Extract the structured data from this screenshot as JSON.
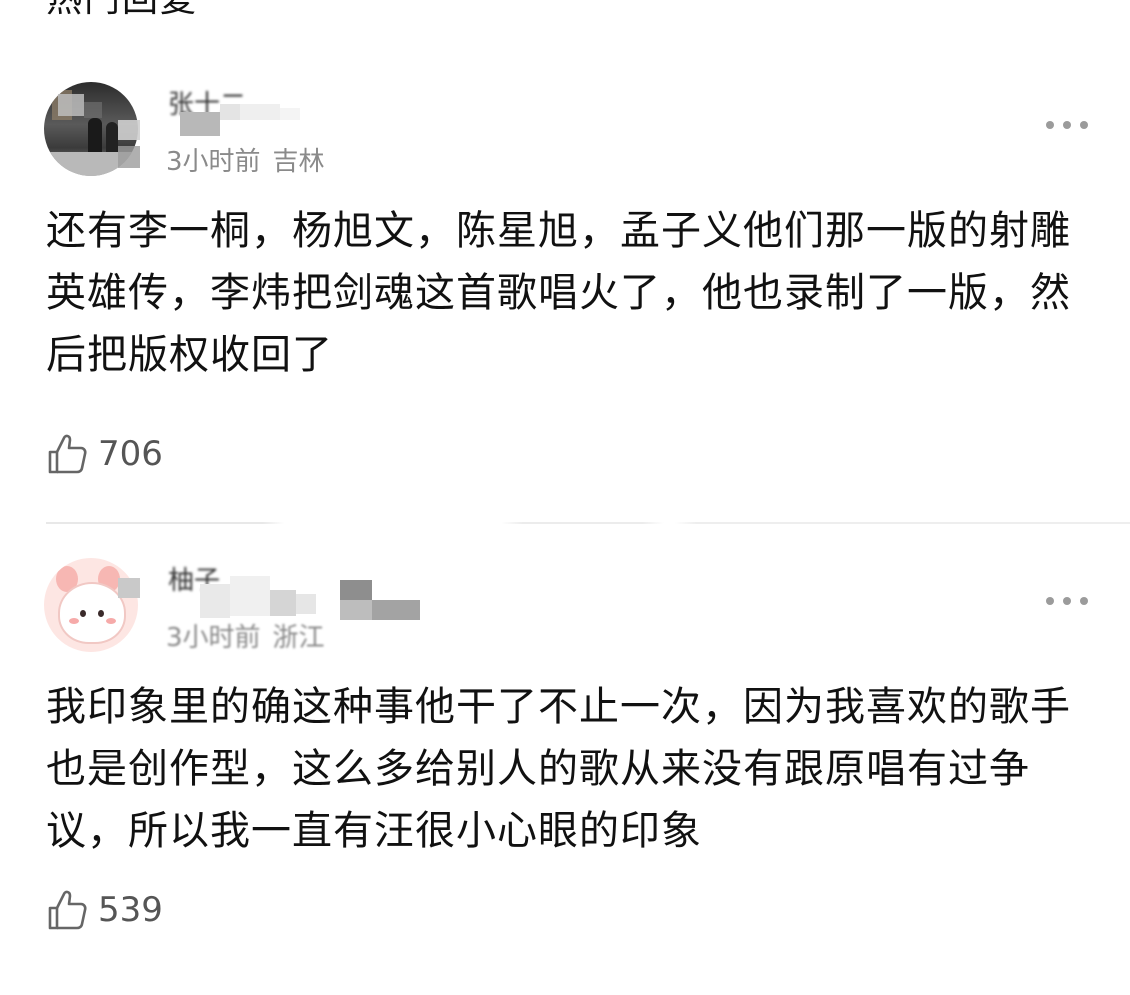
{
  "section": {
    "title": "热门回复"
  },
  "comments": [
    {
      "username": "张十二",
      "time": "3小时前",
      "location": "吉林",
      "content": "还有李一桐，杨旭文，陈星旭，孟子义他们那一版的射雕英雄传，李炜把剑魂这首歌唱火了，他也录制了一版，然后把版权收回了",
      "likes": "706"
    },
    {
      "username": "柚子",
      "time": "3小时前",
      "location": "浙江",
      "content": "我印象里的确这种事他干了不止一次，因为我喜欢的歌手也是创作型，这么多给别人的歌从来没有跟原唱有过争议，所以我一直有汪很小心眼的印象",
      "likes": "539"
    }
  ],
  "icons": {
    "like": "thumbs-up-icon",
    "more": "more-dots-icon",
    "avatar_1": "user-photo-avatar",
    "avatar_2": "cartoon-avatar"
  },
  "colors": {
    "text_primary": "#111111",
    "text_meta": "#8a8a8a",
    "icon_gray": "#9b9b9b",
    "background": "#ffffff"
  }
}
